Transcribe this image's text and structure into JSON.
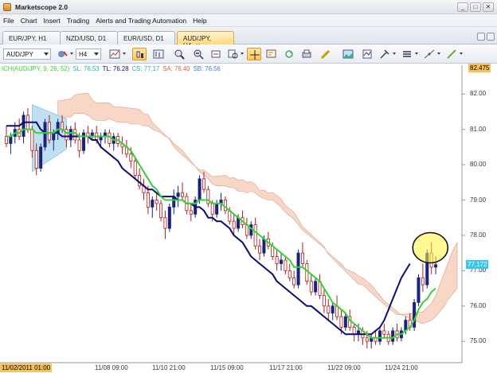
{
  "window": {
    "title": "Marketscope 2.0",
    "controls": [
      "_",
      "□",
      "✕"
    ]
  },
  "menu": [
    "File",
    "Chart",
    "Insert",
    "Trading",
    "Alerts and Trading Automation",
    "Help"
  ],
  "tabs": [
    {
      "label": "EUR/JPY, H1",
      "active": false
    },
    {
      "label": "NZD/USD, D1",
      "active": false
    },
    {
      "label": "EUR/USD, D1",
      "active": false
    },
    {
      "label": "AUD/JPY, H4",
      "active": true,
      "close": "✕"
    }
  ],
  "toolbar": {
    "instrument": "AUD/JPY",
    "timeframe": "H4"
  },
  "legend": {
    "indicator": "ICH(AUD/JPY, 9, 26, 52)",
    "sl": "SL: 76.53",
    "tl": "TL: 76.28",
    "cs": "CS: 77.17",
    "sa": "SA: 76.40",
    "sb": "SB: 76.56",
    "colors": {
      "indicator": "#35d235",
      "sl": "#15b9b9",
      "tl": "#0c0c74",
      "cs": "#2aaac4",
      "sa": "#d0613c",
      "sb": "#3a7fd4"
    }
  },
  "y_axis": {
    "top_tag": "82.475",
    "labels": [
      "82.00",
      "81.00",
      "80.00",
      "79.00",
      "78.00",
      "77.00",
      "76.00",
      "75.00"
    ],
    "current_price": "77.172"
  },
  "x_axis": {
    "start_tag": "11/02/2011 01:00",
    "labels": [
      "11/08 09:00",
      "11/10 21:00",
      "11/15 09:00",
      "11/17 21:00",
      "11/22 09:00",
      "11/24 21:00"
    ]
  },
  "chart_data": {
    "type": "candlestick",
    "title": "",
    "ylim": [
      74.6,
      82.5
    ],
    "ticks": [
      82,
      81,
      80,
      79,
      78,
      77,
      76,
      75
    ],
    "current_price": 77.172,
    "candles": [
      [
        80.8,
        81.1,
        80.5,
        80.6
      ],
      [
        80.6,
        80.9,
        80.3,
        80.8
      ],
      [
        80.8,
        81.2,
        80.6,
        81.0
      ],
      [
        81.0,
        81.3,
        80.7,
        80.8
      ],
      [
        80.8,
        81.5,
        80.6,
        81.4
      ],
      [
        81.4,
        81.6,
        80.9,
        81.0
      ],
      [
        81.0,
        81.1,
        80.2,
        80.4
      ],
      [
        80.4,
        80.6,
        79.7,
        79.9
      ],
      [
        79.9,
        80.6,
        79.8,
        80.5
      ],
      [
        80.5,
        81.3,
        80.4,
        81.2
      ],
      [
        81.2,
        81.4,
        80.6,
        80.7
      ],
      [
        80.7,
        81.0,
        80.4,
        80.9
      ],
      [
        80.9,
        81.3,
        80.7,
        81.2
      ],
      [
        81.2,
        81.4,
        80.9,
        81.0
      ],
      [
        81.0,
        81.1,
        80.5,
        80.7
      ],
      [
        80.7,
        81.1,
        80.5,
        81.0
      ],
      [
        81.0,
        81.2,
        80.6,
        80.7
      ],
      [
        80.7,
        80.9,
        80.2,
        80.4
      ],
      [
        80.4,
        81.0,
        80.3,
        80.9
      ],
      [
        80.9,
        81.1,
        80.6,
        80.8
      ],
      [
        80.8,
        81.0,
        80.7,
        80.9
      ],
      [
        80.9,
        81.1,
        80.6,
        80.7
      ],
      [
        80.7,
        80.9,
        80.5,
        80.8
      ],
      [
        80.8,
        81.0,
        80.6,
        80.9
      ],
      [
        80.9,
        81.0,
        80.5,
        80.6
      ],
      [
        80.6,
        80.9,
        80.4,
        80.8
      ],
      [
        80.8,
        80.9,
        80.5,
        80.6
      ],
      [
        80.6,
        80.8,
        80.3,
        80.5
      ],
      [
        80.5,
        80.7,
        80.2,
        80.3
      ],
      [
        80.3,
        80.5,
        79.9,
        80.1
      ],
      [
        80.1,
        80.2,
        79.6,
        79.7
      ],
      [
        79.7,
        79.9,
        79.3,
        79.4
      ],
      [
        79.4,
        79.6,
        79.0,
        79.2
      ],
      [
        79.2,
        79.4,
        78.6,
        78.8
      ],
      [
        78.8,
        79.1,
        78.5,
        79.0
      ],
      [
        79.0,
        79.2,
        78.7,
        78.9
      ],
      [
        78.9,
        79.0,
        78.4,
        78.5
      ],
      [
        78.5,
        78.7,
        77.9,
        78.2
      ],
      [
        78.2,
        78.9,
        78.1,
        78.8
      ],
      [
        78.8,
        79.3,
        78.6,
        79.1
      ],
      [
        79.1,
        79.4,
        78.8,
        79.2
      ],
      [
        79.2,
        79.5,
        79.0,
        79.1
      ],
      [
        79.1,
        79.2,
        78.6,
        78.7
      ],
      [
        78.7,
        78.9,
        78.4,
        78.6
      ],
      [
        78.6,
        79.1,
        78.5,
        79.0
      ],
      [
        79.0,
        79.7,
        78.9,
        79.6
      ],
      [
        79.6,
        79.8,
        79.2,
        79.3
      ],
      [
        79.3,
        79.4,
        78.8,
        78.9
      ],
      [
        78.9,
        79.0,
        78.4,
        78.6
      ],
      [
        78.6,
        79.0,
        78.5,
        78.9
      ],
      [
        78.9,
        79.2,
        78.7,
        79.0
      ],
      [
        79.0,
        79.1,
        78.6,
        78.7
      ],
      [
        78.7,
        78.8,
        78.3,
        78.4
      ],
      [
        78.4,
        78.6,
        78.0,
        78.2
      ],
      [
        78.2,
        78.6,
        78.1,
        78.5
      ],
      [
        78.5,
        78.7,
        78.2,
        78.3
      ],
      [
        78.3,
        78.5,
        77.9,
        78.0
      ],
      [
        78.0,
        78.4,
        77.9,
        78.3
      ],
      [
        78.3,
        78.5,
        77.6,
        77.7
      ],
      [
        77.7,
        77.9,
        77.3,
        77.5
      ],
      [
        77.5,
        78.0,
        77.4,
        77.9
      ],
      [
        77.9,
        78.1,
        77.6,
        77.7
      ],
      [
        77.7,
        77.8,
        77.3,
        77.4
      ],
      [
        77.4,
        77.6,
        77.0,
        77.2
      ],
      [
        77.2,
        77.5,
        77.0,
        77.3
      ],
      [
        77.3,
        77.4,
        76.9,
        77.0
      ],
      [
        77.0,
        77.2,
        76.7,
        76.8
      ],
      [
        76.8,
        77.0,
        76.5,
        76.6
      ],
      [
        76.6,
        77.6,
        76.5,
        77.5
      ],
      [
        77.5,
        77.8,
        77.1,
        77.2
      ],
      [
        77.2,
        77.3,
        76.6,
        76.7
      ],
      [
        76.7,
        76.9,
        76.3,
        76.4
      ],
      [
        76.4,
        76.8,
        76.3,
        76.7
      ],
      [
        76.7,
        76.9,
        76.2,
        76.3
      ],
      [
        76.3,
        76.5,
        75.8,
        76.0
      ],
      [
        76.0,
        76.2,
        75.6,
        75.8
      ],
      [
        75.8,
        76.1,
        75.6,
        76.0
      ],
      [
        76.0,
        76.3,
        75.6,
        75.7
      ],
      [
        75.7,
        75.9,
        75.2,
        75.4
      ],
      [
        75.4,
        75.8,
        75.3,
        75.7
      ],
      [
        75.7,
        75.9,
        75.3,
        75.4
      ],
      [
        75.4,
        75.5,
        75.0,
        75.2
      ],
      [
        75.2,
        75.5,
        75.0,
        75.3
      ],
      [
        75.3,
        75.4,
        74.9,
        75.1
      ],
      [
        75.1,
        75.3,
        74.8,
        75.0
      ],
      [
        75.0,
        75.2,
        74.8,
        75.1
      ],
      [
        75.1,
        75.3,
        74.9,
        75.0
      ],
      [
        75.0,
        75.4,
        74.9,
        75.3
      ],
      [
        75.3,
        75.5,
        75.1,
        75.2
      ],
      [
        75.2,
        75.3,
        74.9,
        75.0
      ],
      [
        75.0,
        75.4,
        74.9,
        75.3
      ],
      [
        75.3,
        75.5,
        75.0,
        75.1
      ],
      [
        75.1,
        75.4,
        75.0,
        75.3
      ],
      [
        75.3,
        75.7,
        75.2,
        75.6
      ],
      [
        75.6,
        75.8,
        75.3,
        75.4
      ],
      [
        75.4,
        76.2,
        75.3,
        76.1
      ],
      [
        76.1,
        76.9,
        76.0,
        76.8
      ],
      [
        76.8,
        77.2,
        76.4,
        76.6
      ],
      [
        76.6,
        77.6,
        76.5,
        77.5
      ],
      [
        77.5,
        77.8,
        76.9,
        77.1
      ],
      [
        77.1,
        77.4,
        76.9,
        77.17
      ]
    ],
    "tenkan": [
      80.8,
      80.8,
      80.9,
      80.9,
      81.0,
      81.0,
      81.0,
      80.9,
      80.9,
      80.9,
      80.9,
      80.9,
      81.0,
      81.0,
      80.9,
      80.9,
      80.9,
      80.8,
      80.8,
      80.8,
      80.8,
      80.8,
      80.8,
      80.8,
      80.8,
      80.7,
      80.7,
      80.6,
      80.5,
      80.4,
      80.2,
      80.0,
      79.8,
      79.6,
      79.4,
      79.3,
      79.1,
      79.0,
      79.0,
      79.0,
      79.0,
      79.0,
      78.9,
      78.9,
      78.9,
      79.0,
      79.0,
      79.0,
      78.9,
      78.9,
      78.9,
      78.8,
      78.7,
      78.6,
      78.5,
      78.4,
      78.3,
      78.2,
      78.1,
      78.0,
      77.9,
      77.8,
      77.7,
      77.6,
      77.5,
      77.4,
      77.3,
      77.1,
      77.1,
      77.1,
      77.0,
      76.9,
      76.8,
      76.7,
      76.5,
      76.3,
      76.1,
      76.0,
      75.9,
      75.8,
      75.6,
      75.5,
      75.4,
      75.3,
      75.2,
      75.1,
      75.1,
      75.1,
      75.1,
      75.1,
      75.1,
      75.2,
      75.2,
      75.3,
      75.4,
      75.6,
      75.9,
      76.1,
      76.2,
      76.4,
      76.5
    ],
    "kijun": [
      81.1,
      81.1,
      81.1,
      81.1,
      81.2,
      81.2,
      81.2,
      81.2,
      81.0,
      80.9,
      80.9,
      80.9,
      80.9,
      80.8,
      80.8,
      80.8,
      80.8,
      80.8,
      80.8,
      80.8,
      80.7,
      80.7,
      80.5,
      80.4,
      80.3,
      80.2,
      80.1,
      79.9,
      79.8,
      79.7,
      79.6,
      79.5,
      79.4,
      79.3,
      79.3,
      79.2,
      79.1,
      79.1,
      79.1,
      79.1,
      79.0,
      79.0,
      78.9,
      78.9,
      78.8,
      78.8,
      78.7,
      78.5,
      78.5,
      78.4,
      78.4,
      78.3,
      78.2,
      78.0,
      77.9,
      77.8,
      77.6,
      77.4,
      77.3,
      77.2,
      77.1,
      77.0,
      76.9,
      76.7,
      76.6,
      76.5,
      76.4,
      76.3,
      76.2,
      76.1,
      76.0,
      76.0,
      75.9,
      75.8,
      75.7,
      75.6,
      75.5,
      75.4,
      75.3,
      75.2,
      75.2,
      75.2,
      75.2,
      75.2,
      75.2,
      75.2,
      75.3,
      75.4,
      75.6,
      75.9,
      76.2,
      76.5,
      76.8,
      77.0,
      77.2
    ]
  }
}
